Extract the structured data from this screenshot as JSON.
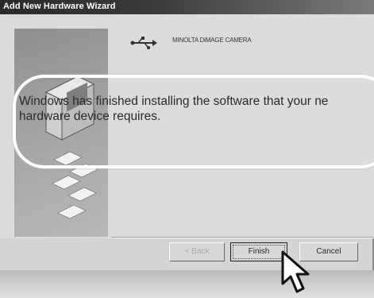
{
  "window": {
    "title": "Add New Hardware Wizard"
  },
  "device": {
    "icon": "usb-icon",
    "name": "MINOLTA DiMAGE CAMERA"
  },
  "message": {
    "line1": "Windows has finished installing the software that your ne",
    "line2": "hardware device requires."
  },
  "buttons": {
    "back_label": "< Back",
    "finish_label": "Finish",
    "cancel_label": "Cancel"
  },
  "colors": {
    "titlebar": "#2a2a2a",
    "dialog_bg": "#dcdcdc",
    "highlight": "#ffffff"
  }
}
